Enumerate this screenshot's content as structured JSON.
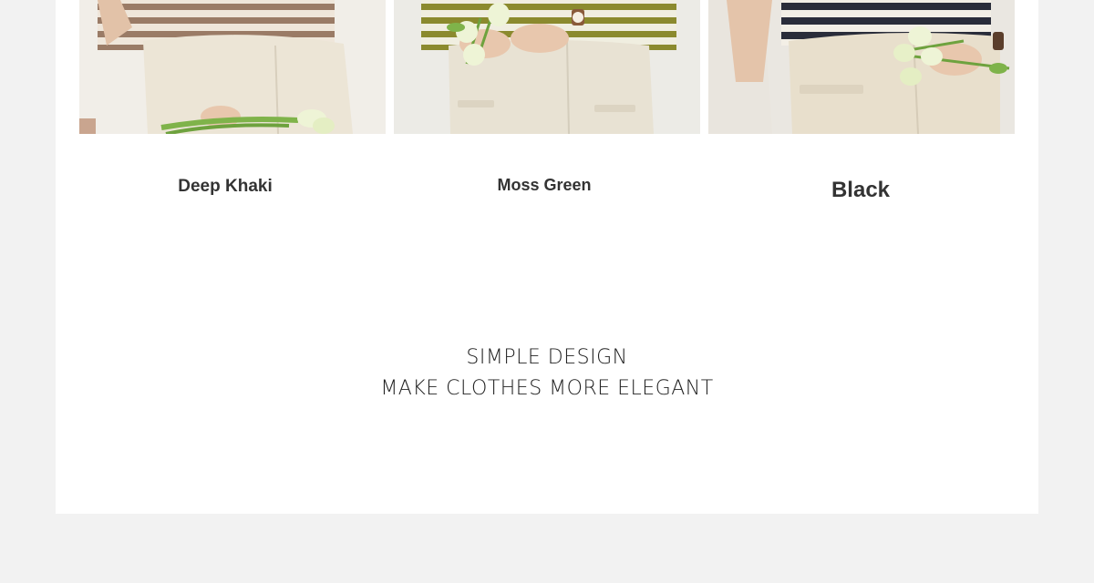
{
  "variants": [
    {
      "color_name": "Deep Khaki",
      "stripe_color": "#9a7b66",
      "pants_color": "#ece5d6"
    },
    {
      "color_name": "Moss Green",
      "stripe_color": "#8b8a2e",
      "pants_color": "#e8e2d3"
    },
    {
      "color_name": "Black",
      "stripe_color": "#2a2d3a",
      "pants_color": "#e8dfcc"
    }
  ],
  "tagline": {
    "line1": "SIMPLE DESIGN",
    "line2": "MAKE CLOTHES MORE ELEGANT"
  },
  "colors": {
    "page_background": "#f2f2f2",
    "panel_background": "#ffffff",
    "label_text": "#333333",
    "tulip_leaf": "#7fb34a",
    "tulip_petal": "#eef4d6"
  }
}
